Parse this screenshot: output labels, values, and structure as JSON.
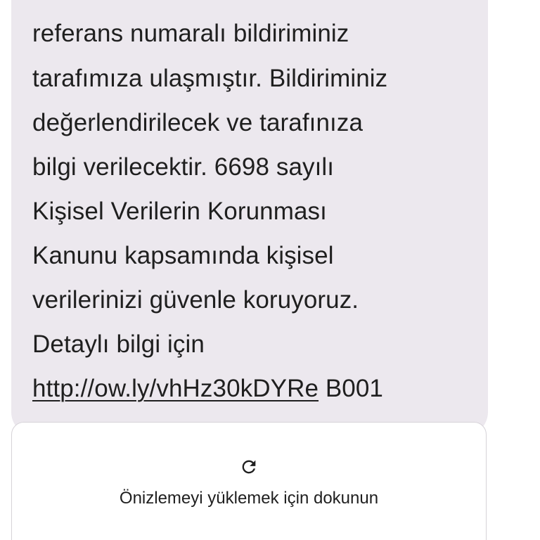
{
  "message": {
    "lines": [
      "referans numaralı bildiriminiz",
      "tarafımıza ulaşmıştır. Bildiriminiz",
      "değerlendirilecek ve tarafınıza",
      "bilgi verilecektir. 6698 sayılı",
      "Kişisel Verilerin Korunması",
      "Kanunu kapsamında kişisel",
      "verilerinizi güvenle koruyoruz.",
      "Detaylı bilgi için"
    ],
    "link_text": "http://ow.ly/vhHz30kDYRe",
    "suffix": " B001"
  },
  "link_preview": {
    "icon": "refresh-icon",
    "label": "Önizlemeyi yüklemek için dokunun"
  }
}
